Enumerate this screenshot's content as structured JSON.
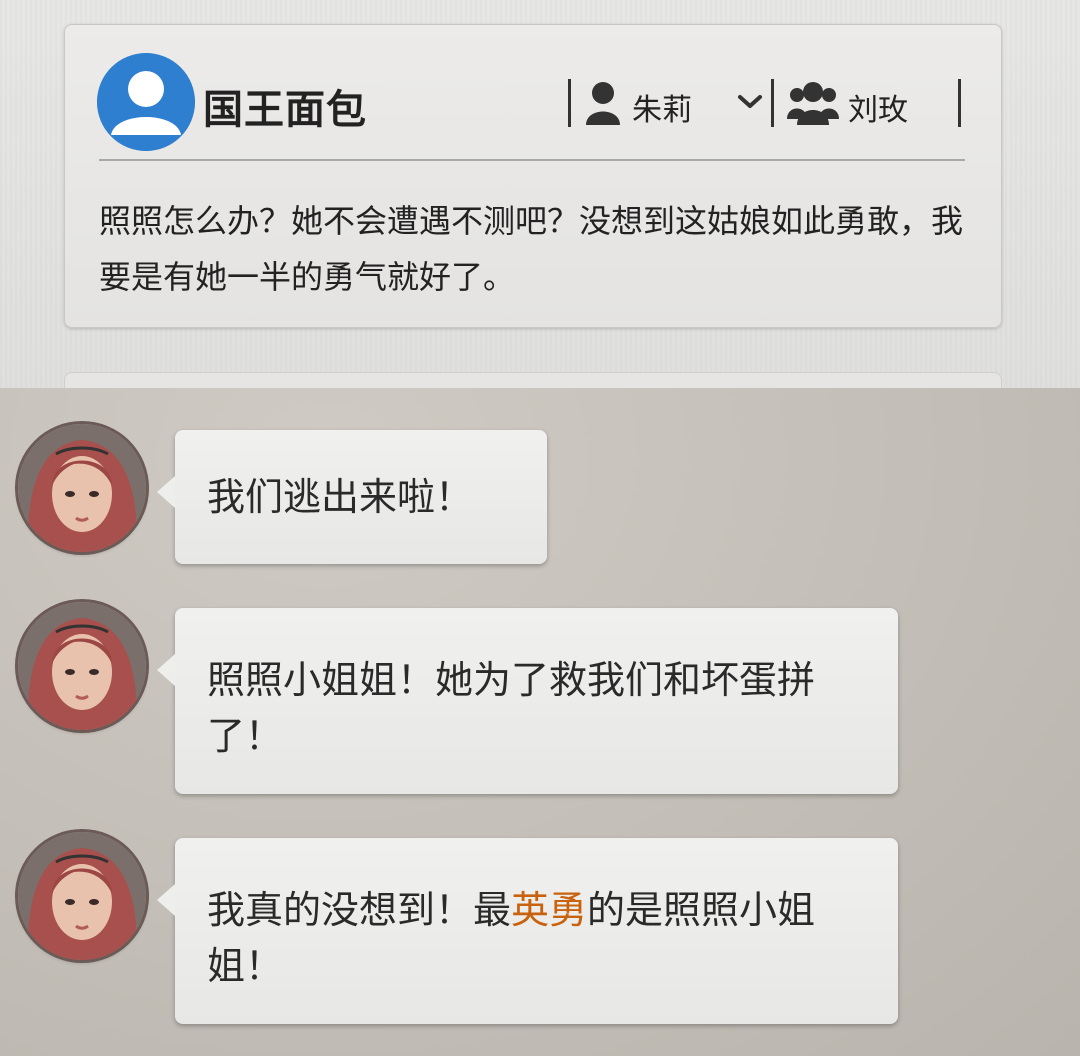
{
  "post": {
    "author": "国王面包",
    "role_left": "朱莉",
    "role_right": "刘玫",
    "body": "照照怎么办？她不会遭遇不测吧？没想到这姑娘如此勇敢，我要是有她一半的勇气就好了。"
  },
  "messages": [
    {
      "text": "我们逃出来啦！"
    },
    {
      "text": "照照小姐姐！她为了救我们和坏蛋拼了！"
    },
    {
      "text_before": "我真的没想到！最",
      "text_highlight": "英勇",
      "text_after": "的是照照小姐姐！"
    }
  ],
  "colors": {
    "avatar_blue": "#2f7fd0",
    "highlight": "#c8620f"
  },
  "icons": {
    "author_avatar": "default-user-avatar",
    "role_left": "person-icon",
    "role_right": "group-icon",
    "dropdown": "chevron-down-icon"
  }
}
